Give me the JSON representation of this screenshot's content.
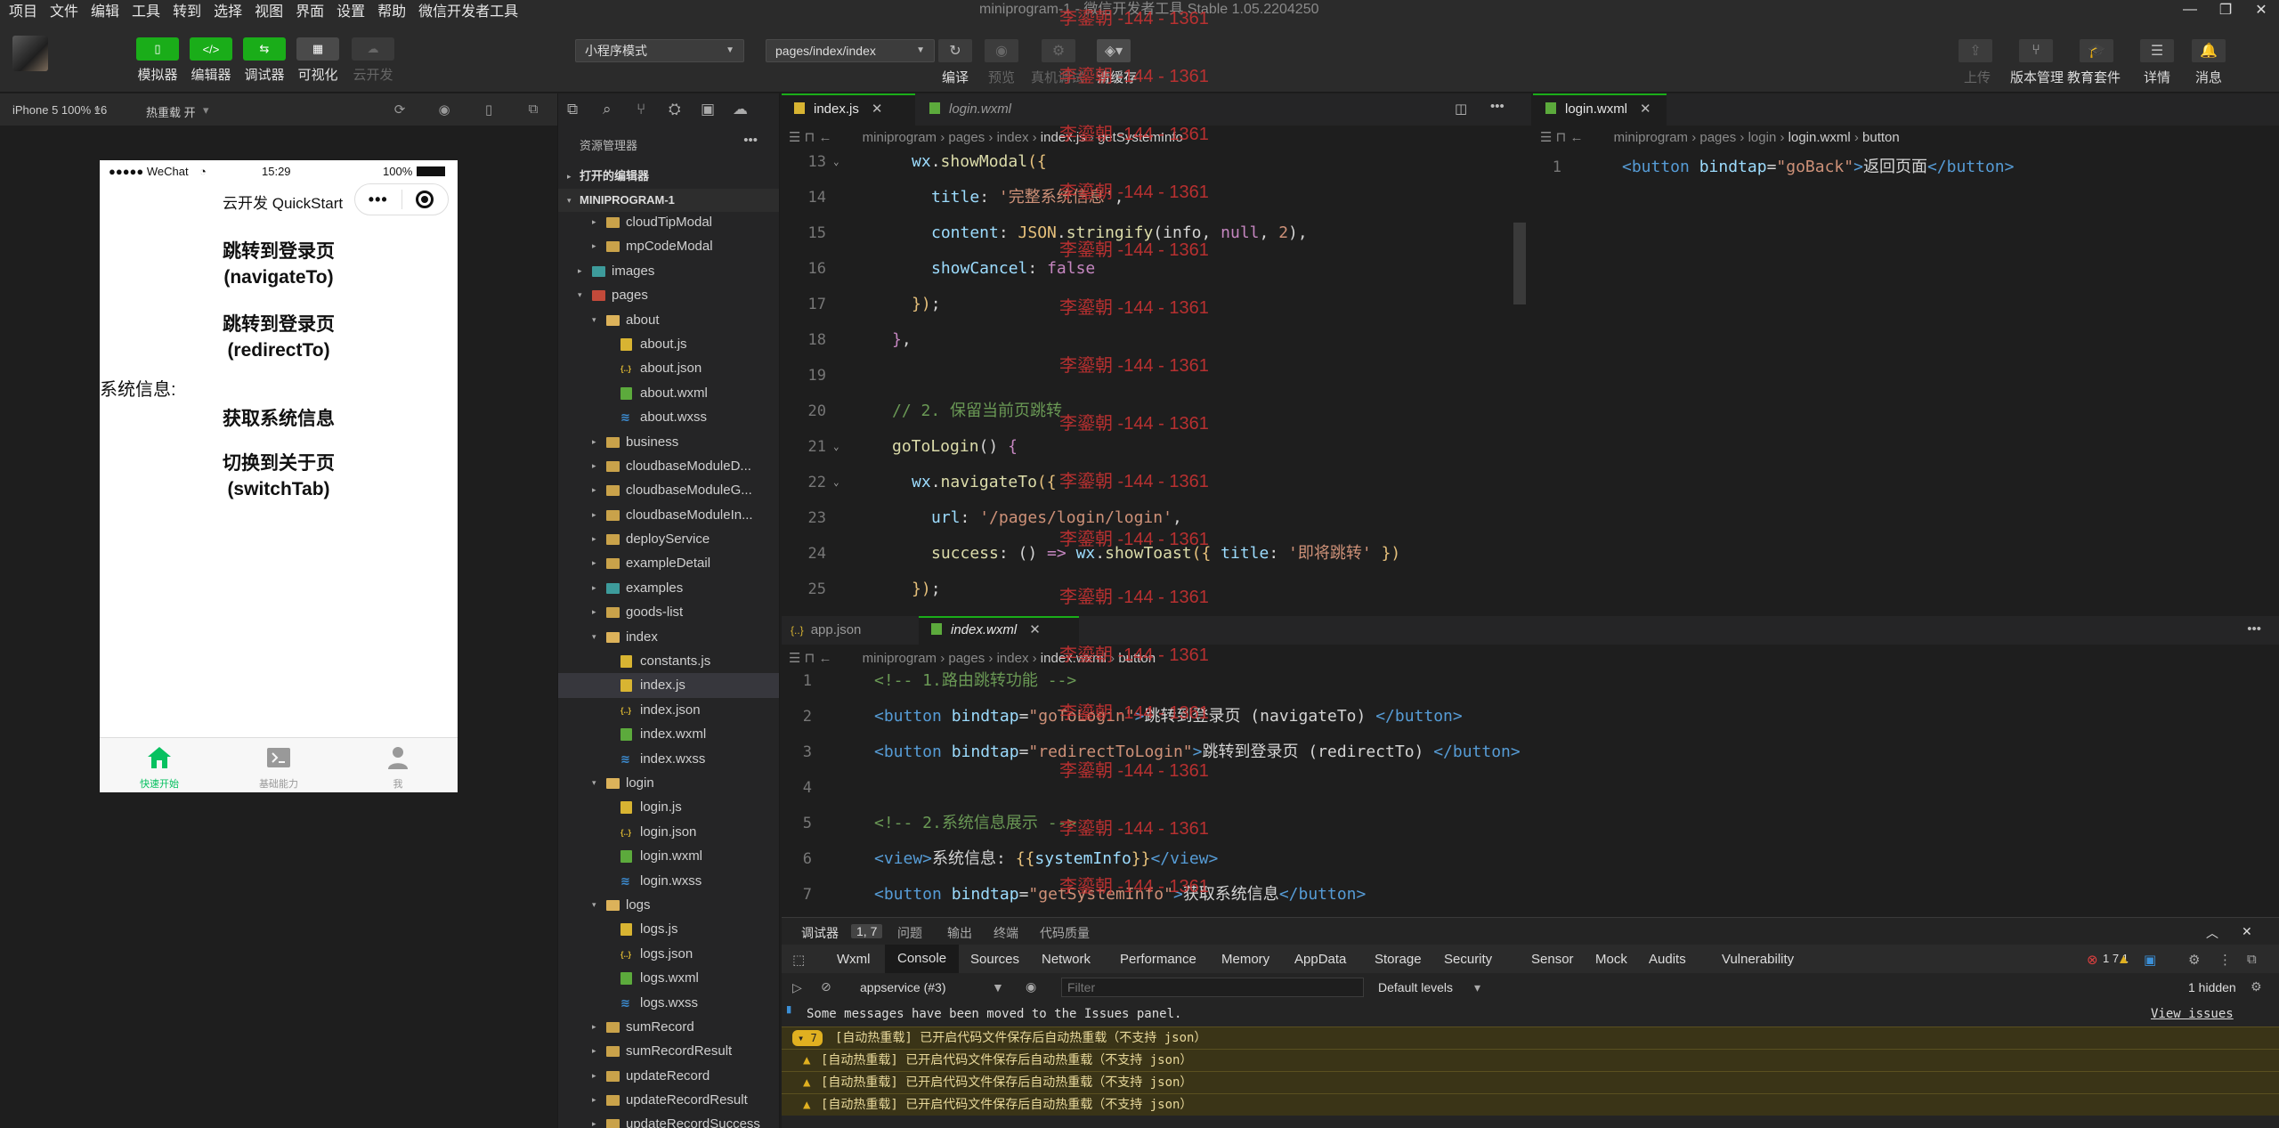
{
  "menu": [
    "项目",
    "文件",
    "编辑",
    "工具",
    "转到",
    "选择",
    "视图",
    "界面",
    "设置",
    "帮助",
    "微信开发者工具"
  ],
  "window_title": "miniprogram-1 - 微信开发者工具 Stable 1.05.2204250",
  "toolbar": {
    "simulator": "模拟器",
    "editor": "编辑器",
    "debugger": "调试器",
    "visual": "可视化",
    "cloud": "云开发",
    "mode_select": "小程序模式",
    "page_select": "pages/index/index",
    "compile": "编译",
    "preview": "预览",
    "real_debug": "真机调试",
    "clear_cache": "清缓存",
    "upload": "上传",
    "version": "版本管理",
    "edu": "教育套件",
    "details": "详情",
    "messages": "消息"
  },
  "simbar": {
    "device": "iPhone 5 100% 16",
    "hot_reload": "热重载 开"
  },
  "phone": {
    "carrier": "●●●●● WeChat",
    "time": "15:29",
    "battery": "100%",
    "nav_title": "云开发 QuickStart",
    "btn1_line1": "跳转到登录页",
    "btn1_line2": "(navigateTo)",
    "btn2_line1": "跳转到登录页",
    "btn2_line2": "(redirectTo)",
    "sysinfo_label": "系统信息:",
    "btn3": "获取系统信息",
    "btn4_line1": "切换到关于页",
    "btn4_line2": "(switchTab)",
    "tabs": [
      "快速开始",
      "基础能力",
      "我"
    ]
  },
  "explorer": {
    "title": "资源管理器",
    "open_editors": "打开的编辑器",
    "project": "MINIPROGRAM-1",
    "tree": [
      {
        "name": "cloudTipModal",
        "type": "folder",
        "depth": 1,
        "arrow": "▸"
      },
      {
        "name": "mpCodeModal",
        "type": "folder",
        "depth": 1,
        "arrow": "▸"
      },
      {
        "name": "images",
        "type": "folder-teal",
        "depth": 0,
        "arrow": "▸"
      },
      {
        "name": "pages",
        "type": "folder-red",
        "depth": 0,
        "arrow": "▾"
      },
      {
        "name": "about",
        "type": "folder",
        "depth": 1,
        "arrow": "▾"
      },
      {
        "name": "about.js",
        "type": "js",
        "depth": 2
      },
      {
        "name": "about.json",
        "type": "json",
        "depth": 2
      },
      {
        "name": "about.wxml",
        "type": "wxml",
        "depth": 2
      },
      {
        "name": "about.wxss",
        "type": "wxss",
        "depth": 2
      },
      {
        "name": "business",
        "type": "folder",
        "depth": 1,
        "arrow": "▸"
      },
      {
        "name": "cloudbaseModuleD...",
        "type": "folder",
        "depth": 1,
        "arrow": "▸"
      },
      {
        "name": "cloudbaseModuleG...",
        "type": "folder",
        "depth": 1,
        "arrow": "▸"
      },
      {
        "name": "cloudbaseModuleIn...",
        "type": "folder",
        "depth": 1,
        "arrow": "▸"
      },
      {
        "name": "deployService",
        "type": "folder",
        "depth": 1,
        "arrow": "▸"
      },
      {
        "name": "exampleDetail",
        "type": "folder",
        "depth": 1,
        "arrow": "▸"
      },
      {
        "name": "examples",
        "type": "folder-teal",
        "depth": 1,
        "arrow": "▸"
      },
      {
        "name": "goods-list",
        "type": "folder",
        "depth": 1,
        "arrow": "▸"
      },
      {
        "name": "index",
        "type": "folder",
        "depth": 1,
        "arrow": "▾"
      },
      {
        "name": "constants.js",
        "type": "js",
        "depth": 2
      },
      {
        "name": "index.js",
        "type": "js",
        "depth": 2,
        "selected": true
      },
      {
        "name": "index.json",
        "type": "json",
        "depth": 2
      },
      {
        "name": "index.wxml",
        "type": "wxml",
        "depth": 2
      },
      {
        "name": "index.wxss",
        "type": "wxss",
        "depth": 2
      },
      {
        "name": "login",
        "type": "folder",
        "depth": 1,
        "arrow": "▾"
      },
      {
        "name": "login.js",
        "type": "js",
        "depth": 2
      },
      {
        "name": "login.json",
        "type": "json",
        "depth": 2
      },
      {
        "name": "login.wxml",
        "type": "wxml",
        "depth": 2
      },
      {
        "name": "login.wxss",
        "type": "wxss",
        "depth": 2
      },
      {
        "name": "logs",
        "type": "folder",
        "depth": 1,
        "arrow": "▾"
      },
      {
        "name": "logs.js",
        "type": "js",
        "depth": 2
      },
      {
        "name": "logs.json",
        "type": "json",
        "depth": 2
      },
      {
        "name": "logs.wxml",
        "type": "wxml",
        "depth": 2
      },
      {
        "name": "logs.wxss",
        "type": "wxss",
        "depth": 2
      },
      {
        "name": "sumRecord",
        "type": "folder",
        "depth": 1,
        "arrow": "▸"
      },
      {
        "name": "sumRecordResult",
        "type": "folder",
        "depth": 1,
        "arrow": "▸"
      },
      {
        "name": "updateRecord",
        "type": "folder",
        "depth": 1,
        "arrow": "▸"
      },
      {
        "name": "updateRecordResult",
        "type": "folder",
        "depth": 1,
        "arrow": "▸"
      },
      {
        "name": "updateRecordSuccess",
        "type": "folder",
        "depth": 1,
        "arrow": "▸"
      }
    ]
  },
  "editor_main": {
    "tabs": [
      "index.js",
      "login.wxml"
    ],
    "crumbs": [
      "miniprogram",
      "pages",
      "index",
      "index.js",
      "getSystemInfo"
    ],
    "lines": [
      {
        "n": 13,
        "html": "<span class=\"prop\">wx</span><span class=\"txt\">.</span><span class=\"fn\">showModal</span><span class=\"obj\">({</span>",
        "indent": 1,
        "fold": true
      },
      {
        "n": 14,
        "html": "<span class=\"prop\">title</span><span class=\"txt\">: </span><span class=\"str\">'完整系统信息'</span><span class=\"txt\">,</span>",
        "indent": 2
      },
      {
        "n": 15,
        "html": "<span class=\"prop\">content</span><span class=\"txt\">: </span><span class=\"obj\">JSON</span><span class=\"txt\">.</span><span class=\"fn\">stringify</span><span class=\"txt\">(info, </span><span class=\"kw\">null</span><span class=\"txt\">, </span><span class=\"str\">2</span><span class=\"txt\">),</span>",
        "indent": 2
      },
      {
        "n": 16,
        "html": "<span class=\"prop\">showCancel</span><span class=\"txt\">: </span><span class=\"kw\">false</span>",
        "indent": 2
      },
      {
        "n": 17,
        "html": "<span class=\"obj\">})</span><span class=\"txt\">;</span>",
        "indent": 1
      },
      {
        "n": 18,
        "html": "<span class=\"kw\">}</span><span class=\"txt\">,</span>",
        "indent": 0
      },
      {
        "n": 19,
        "html": "",
        "indent": 0
      },
      {
        "n": 20,
        "html": "<span class=\"cmt\">// 2. 保留当前页跳转</span>",
        "indent": 0
      },
      {
        "n": 21,
        "html": "<span class=\"fn\">goToLogin</span><span class=\"txt\">() </span><span class=\"kw\">{</span>",
        "indent": 0,
        "fold": true
      },
      {
        "n": 22,
        "html": "<span class=\"prop\">wx</span><span class=\"txt\">.</span><span class=\"fn\">navigateTo</span><span class=\"obj\">({</span>",
        "indent": 1,
        "fold": true
      },
      {
        "n": 23,
        "html": "<span class=\"prop\">url</span><span class=\"txt\">: </span><span class=\"str\">'/pages/login/login'</span><span class=\"txt\">,</span>",
        "indent": 2
      },
      {
        "n": 24,
        "html": "<span class=\"fn\">success</span><span class=\"txt\">: () </span><span class=\"kw\">=&gt;</span><span class=\"txt\"> </span><span class=\"prop\">wx</span><span class=\"txt\">.</span><span class=\"fn\">showToast</span><span class=\"obj\">({ </span><span class=\"prop\">title</span><span class=\"txt\">: </span><span class=\"str\">'即将跳转'</span><span class=\"obj\"> })</span>",
        "indent": 2
      },
      {
        "n": 25,
        "html": "<span class=\"obj\">})</span><span class=\"txt\">;</span>",
        "indent": 1
      }
    ]
  },
  "editor_right": {
    "tab": "login.wxml",
    "crumbs": [
      "miniprogram",
      "pages",
      "login",
      "login.wxml",
      "button"
    ],
    "lines": [
      {
        "n": 1,
        "html": "<span class=\"tag\">&lt;button</span> <span class=\"attr\">bindtap</span><span class=\"txt\">=</span><span class=\"str\">\"goBack\"</span><span class=\"tag\">&gt;</span><span class=\"txt\">返回页面</span><span class=\"tag\">&lt;/button&gt;</span>"
      }
    ]
  },
  "editor_bottom": {
    "tabs": [
      "app.json",
      "index.wxml"
    ],
    "crumbs": [
      "miniprogram",
      "pages",
      "index",
      "index.wxml",
      "button"
    ],
    "lines": [
      {
        "n": 1,
        "html": "<span class=\"cmt\">&lt;!-- 1.路由跳转功能 --&gt;</span>"
      },
      {
        "n": 2,
        "html": "<span class=\"tag\">&lt;button</span> <span class=\"attr\">bindtap</span><span class=\"txt\">=</span><span class=\"str\">\"goToLogin\"</span><span class=\"tag\">&gt;</span><span class=\"txt\">跳转到登录页 (navigateTo) </span><span class=\"tag\">&lt;/button&gt;</span>"
      },
      {
        "n": 3,
        "html": "<span class=\"tag\">&lt;button</span> <span class=\"attr\">bindtap</span><span class=\"txt\">=</span><span class=\"str\">\"redirectToLogin\"</span><span class=\"tag\">&gt;</span><span class=\"txt\">跳转到登录页 (redirectTo) </span><span class=\"tag\">&lt;/button&gt;</span>"
      },
      {
        "n": 4,
        "html": ""
      },
      {
        "n": 5,
        "html": "<span class=\"cmt\">&lt;!-- 2.系统信息展示 --&gt;</span>"
      },
      {
        "n": 6,
        "html": "<span class=\"tag\">&lt;view&gt;</span><span class=\"txt\">系统信息: </span><span class=\"obj\">{{</span><span class=\"prop\">systemInfo</span><span class=\"obj\">}}</span><span class=\"tag\">&lt;/view&gt;</span>"
      },
      {
        "n": 7,
        "html": "<span class=\"tag\">&lt;button</span> <span class=\"attr\">bindtap</span><span class=\"txt\">=</span><span class=\"str\">\"getSystemInfo\"</span><span class=\"tag\">&gt;</span><span class=\"txt\">获取系统信息</span><span class=\"tag\">&lt;/button&gt;</span>"
      }
    ]
  },
  "watermark": "李鎏朝 -144 - 1361",
  "console": {
    "top_tabs": [
      "调试器",
      "1, 7",
      "问题",
      "输出",
      "终端",
      "代码质量"
    ],
    "dev_tabs": [
      "Wxml",
      "Console",
      "Sources",
      "Network",
      "Performance",
      "Memory",
      "AppData",
      "Storage",
      "Security",
      "Sensor",
      "Mock",
      "Audits",
      "Vulnerability"
    ],
    "counts": "1  7  1",
    "context": "appservice (#3)",
    "filter_placeholder": "Filter",
    "levels": "Default levels",
    "hidden": "1 hidden",
    "messages_moved": "Some messages have been moved to the Issues panel.",
    "view_issues": "View issues",
    "warn_text": "[自动热重载] 已开启代码文件保存后自动热重载（不支持 json）",
    "badge_count": "7"
  },
  "colors": {
    "accent": "#1aad19",
    "watermark": "#c83232",
    "tab_active": "#07c160"
  }
}
